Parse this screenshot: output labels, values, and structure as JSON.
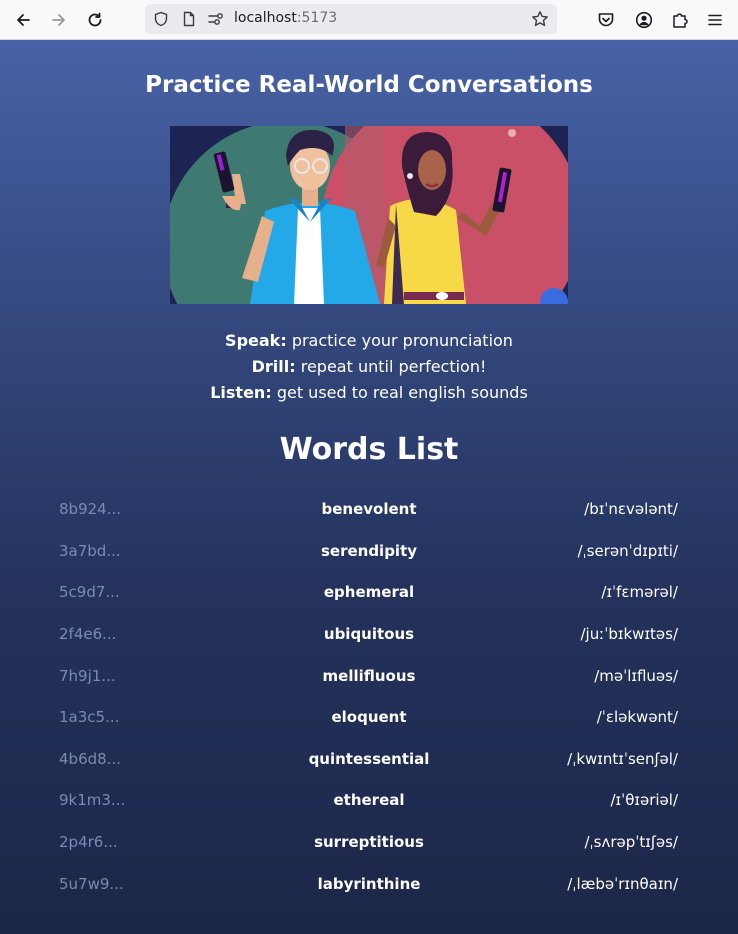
{
  "browser": {
    "url_host": "localhost",
    "url_port": ":5173"
  },
  "page": {
    "headline": "Practice Real-World Conversations",
    "features": [
      {
        "label": "Speak:",
        "text": "practice your pronunciation"
      },
      {
        "label": "Drill:",
        "text": "repeat until perfection!"
      },
      {
        "label": "Listen:",
        "text": "get used to real english sounds"
      }
    ],
    "words_title": "Words List",
    "words": [
      {
        "id": "8b924...",
        "word": "benevolent",
        "ipa": "/bɪˈnɛvələnt/"
      },
      {
        "id": "3a7bd...",
        "word": "serendipity",
        "ipa": "/ˌserənˈdɪpɪti/"
      },
      {
        "id": "5c9d7...",
        "word": "ephemeral",
        "ipa": "/ɪˈfɛmərəl/"
      },
      {
        "id": "2f4e6...",
        "word": "ubiquitous",
        "ipa": "/juːˈbɪkwɪtəs/"
      },
      {
        "id": "7h9j1...",
        "word": "mellifluous",
        "ipa": "/məˈlɪfluəs/"
      },
      {
        "id": "1a3c5...",
        "word": "eloquent",
        "ipa": "/ˈɛləkwənt/"
      },
      {
        "id": "4b6d8...",
        "word": "quintessential",
        "ipa": "/ˌkwɪntɪˈsenʃəl/"
      },
      {
        "id": "9k1m3...",
        "word": "ethereal",
        "ipa": "/ɪˈθɪəriəl/"
      },
      {
        "id": "2p4r6...",
        "word": "surreptitious",
        "ipa": "/ˌsʌrəpˈtɪʃəs/"
      },
      {
        "id": "5u7w9...",
        "word": "labyrinthine",
        "ipa": "/ˌlæbəˈrɪnθaɪn/"
      }
    ]
  }
}
